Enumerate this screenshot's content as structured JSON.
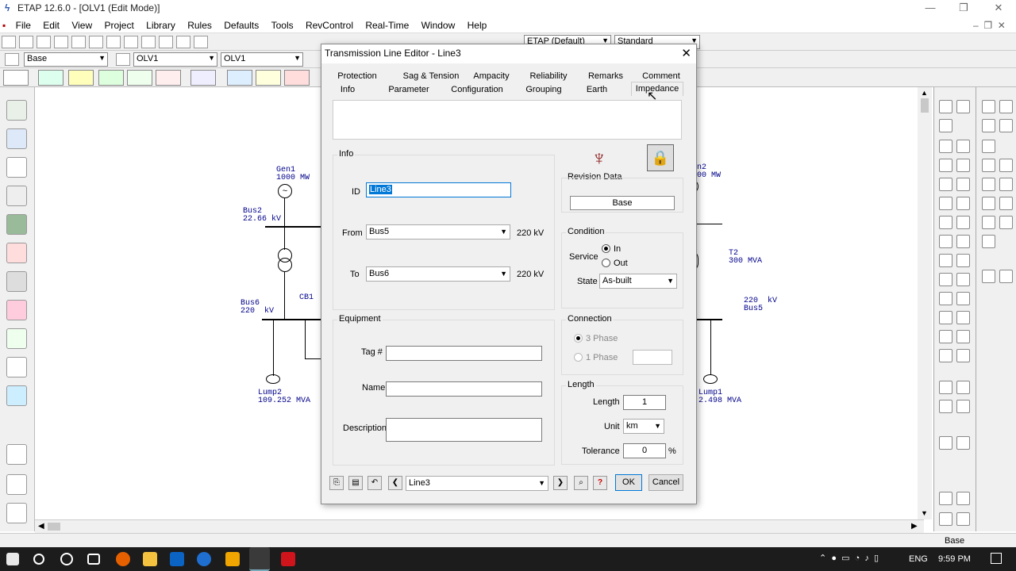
{
  "window": {
    "title": "ETAP 12.6.0 - [OLV1 (Edit Mode)]",
    "min": "—",
    "max": "❐",
    "close": "✕"
  },
  "menu": [
    "File",
    "Edit",
    "View",
    "Project",
    "Library",
    "Rules",
    "Defaults",
    "Tools",
    "RevControl",
    "Real-Time",
    "Window",
    "Help"
  ],
  "toolbar": {
    "config": "ETAP (Default)",
    "standard": "Standard"
  },
  "toolbar2": {
    "base": "Base",
    "olv": "OLV1",
    "olv2": "OLV1"
  },
  "diagram": {
    "gen1": "Gen1\n1000 MW",
    "bus2": "Bus2\n22.66 kV",
    "bus6": "Bus6\n220  kV",
    "cb1": "CB1",
    "lump2": "Lump2\n109.252 MVA",
    "gen2": "n2\n00 MW",
    "t2": "T2\n300 MVA",
    "bus5": "220  kV\nBus5",
    "lump1": "Lump1\n2.498 MVA"
  },
  "dialog": {
    "title": "Transmission Line Editor - Line3",
    "close": "✕",
    "tabs_row1": [
      "Protection",
      "Sag & Tension",
      "Ampacity",
      "Reliability",
      "Remarks",
      "Comment"
    ],
    "tabs_row2": [
      "Info",
      "Parameter",
      "Configuration",
      "Grouping",
      "Earth",
      "Impedance"
    ],
    "info_group": "Info",
    "id_label": "ID",
    "id_value": "Line3",
    "from_label": "From",
    "from_value": "Bus5",
    "from_kv": "220 kV",
    "to_label": "To",
    "to_value": "Bus6",
    "to_kv": "220 kV",
    "revision_label": "Revision Data",
    "revision_value": "Base",
    "condition_group": "Condition",
    "service_label": "Service",
    "service_in": "In",
    "service_out": "Out",
    "state_label": "State",
    "state_value": "As-built",
    "equipment_group": "Equipment",
    "tag_label": "Tag #",
    "tag_value": "",
    "name_label": "Name",
    "name_value": "",
    "desc_label": "Description",
    "desc_value": "",
    "connection_group": "Connection",
    "phase3": "3 Phase",
    "phase1": "1 Phase",
    "length_group": "Length",
    "length_label": "Length",
    "length_value": "1",
    "unit_label": "Unit",
    "unit_value": "km",
    "tolerance_label": "Tolerance",
    "tolerance_value": "0",
    "tolerance_unit": "%",
    "nav_value": "Line3",
    "ok": "OK",
    "cancel": "Cancel"
  },
  "status": {
    "base": "Base"
  },
  "taskbar": {
    "lang": "ENG",
    "time": "9:59 PM"
  }
}
